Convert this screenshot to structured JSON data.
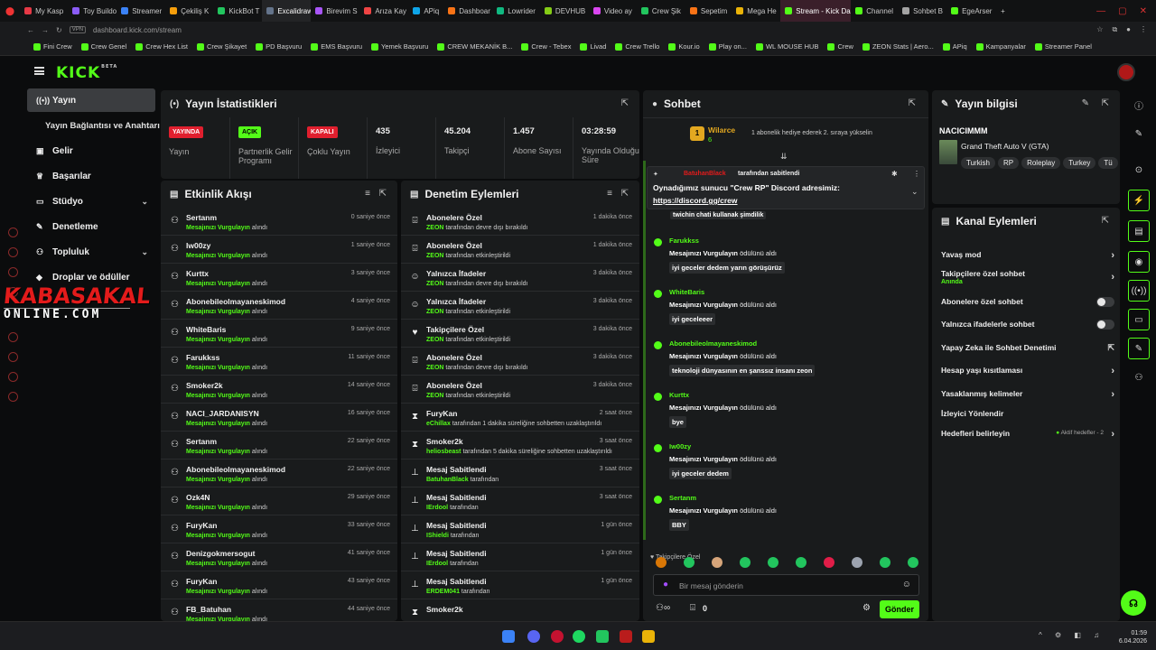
{
  "browser": {
    "tabs": [
      "My Kasp",
      "Toy Buildo",
      "Streamer",
      "Çekiliş K",
      "KickBot T",
      "Excalidraw",
      "Birevim S",
      "Arıza Kay",
      "APiq",
      "Dashboar",
      "Lowrider",
      "DEVHUB",
      "Video ay",
      "Crew Şik",
      "Sepetim",
      "Mega He",
      "Stream - Kick Da",
      "Channel",
      "Sohbet B",
      "EgeArser"
    ],
    "new_tab": "+",
    "url": "dashboard.kick.com/stream",
    "vpn": "VPN",
    "bookmarks": [
      "Fini Crew",
      "Crew Genel",
      "Crew Hex List",
      "Crew Şikayet",
      "PD Başvuru",
      "EMS Başvuru",
      "Yemek Başvuru",
      "CREW MEKANİK B...",
      "Crew - Tebex",
      "Livad",
      "Crew Trello",
      "Kour.io",
      "Play on...",
      "WL MOUSE HUB",
      "Crew",
      "ZEON Stats | Aero...",
      "APiq",
      "Kampanyalar",
      "Streamer Panel"
    ]
  },
  "logo": {
    "text": "KICK",
    "beta": "BETA"
  },
  "sidebar": {
    "yayin": "Yayın",
    "baglanti": "Yayın Bağlantısı ve Anahtarı",
    "gelir": "Gelir",
    "basarilar": "Başarılar",
    "studyo": "Stüdyo",
    "denetleme": "Denetleme",
    "topluluk": "Topluluk",
    "droplar": "Droplar ve ödüller"
  },
  "watermark": {
    "line1": "KABASAKAL",
    "line2": "ONLINE.COM"
  },
  "stats": {
    "title": "Yayın İstatistikleri",
    "items": [
      {
        "badge": "YAYINDA",
        "label": "Yayın"
      },
      {
        "badge": "AÇIK",
        "label": "Partnerlik Gelir Programı"
      },
      {
        "badge": "KAPALI",
        "label": "Çoklu Yayın"
      },
      {
        "value": "435",
        "label": "İzleyici"
      },
      {
        "value": "45.204",
        "label": "Takipçi"
      },
      {
        "value": "1.457",
        "label": "Abone Sayısı"
      },
      {
        "value": "03:28:59",
        "label": "Yayında Olduğu Süre"
      }
    ]
  },
  "activity": {
    "title": "Etkinlik Akışı",
    "prefix": "Mesajınızı Vurgulayın",
    "suffix": "alındı",
    "rows": [
      {
        "name": "Sertanm",
        "time": "0 saniye önce"
      },
      {
        "name": "Iw00zy",
        "time": "1 saniye önce"
      },
      {
        "name": "Kurttx",
        "time": "3 saniye önce"
      },
      {
        "name": "Abonebileolmayaneskimod",
        "time": "4 saniye önce"
      },
      {
        "name": "WhiteBaris",
        "time": "9 saniye önce"
      },
      {
        "name": "Farukkss",
        "time": "11 saniye önce"
      },
      {
        "name": "Smoker2k",
        "time": "14 saniye önce"
      },
      {
        "name": "NACI_JARDANISYN",
        "time": "16 saniye önce"
      },
      {
        "name": "Sertanm",
        "time": "22 saniye önce"
      },
      {
        "name": "Abonebileolmayaneskimod",
        "time": "22 saniye önce"
      },
      {
        "name": "Ozk4N",
        "time": "29 saniye önce"
      },
      {
        "name": "FuryKan",
        "time": "33 saniye önce"
      },
      {
        "name": "Denizgokmersogut",
        "time": "41 saniye önce"
      },
      {
        "name": "FuryKan",
        "time": "43 saniye önce"
      },
      {
        "name": "FB_Batuhan",
        "time": "44 saniye önce"
      }
    ]
  },
  "moderation": {
    "title": "Denetim Eylemleri",
    "rows": [
      {
        "title": "Abonelere Özel",
        "user": "ZEON",
        "text": "tarafından devre dışı bırakıldı",
        "time": "1 dakika önce",
        "icon": "gift-icon"
      },
      {
        "title": "Abonelere Özel",
        "user": "ZEON",
        "text": "tarafından etkinleştirildi",
        "time": "1 dakika önce",
        "icon": "gift-icon"
      },
      {
        "title": "Yalnızca İfadeler",
        "user": "ZEON",
        "text": "tarafından devre dışı bırakıldı",
        "time": "3 dakika önce",
        "icon": "smile-icon"
      },
      {
        "title": "Yalnızca İfadeler",
        "user": "ZEON",
        "text": "tarafından etkinleştirildi",
        "time": "3 dakika önce",
        "icon": "smile-icon"
      },
      {
        "title": "Takipçilere Özel",
        "user": "ZEON",
        "text": "tarafından etkinleştirildi",
        "time": "3 dakika önce",
        "icon": "heart-icon"
      },
      {
        "title": "Abonelere Özel",
        "user": "ZEON",
        "text": "tarafından devre dışı bırakıldı",
        "time": "3 dakika önce",
        "icon": "gift-icon"
      },
      {
        "title": "Abonelere Özel",
        "user": "ZEON",
        "text": "tarafından etkinleştirildi",
        "time": "3 dakika önce",
        "icon": "gift-icon"
      },
      {
        "title": "FuryKan",
        "user": "eChillax",
        "text": "tarafından 1 dakika süreliğine sohbetten uzaklaştırıldı",
        "time": "2 saat önce",
        "icon": "hourglass-icon"
      },
      {
        "title": "Smoker2k",
        "user": "heliosbeast",
        "text": "tarafından 5 dakika süreliğine sohbetten uzaklaştırıldı",
        "time": "3 saat önce",
        "icon": "hourglass-icon"
      },
      {
        "title": "Mesaj Sabitlendi",
        "user": "BatuhanBlack",
        "text": "tarafından",
        "time": "3 saat önce",
        "icon": "pin-icon"
      },
      {
        "title": "Mesaj Sabitlendi",
        "user": "IErdool",
        "text": "tarafından",
        "time": "3 saat önce",
        "icon": "pin-icon"
      },
      {
        "title": "Mesaj Sabitlendi",
        "user": "IShieldi",
        "text": "tarafından",
        "time": "1 gün önce",
        "icon": "pin-icon"
      },
      {
        "title": "Mesaj Sabitlendi",
        "user": "IErdool",
        "text": "tarafından",
        "time": "1 gün önce",
        "icon": "pin-icon"
      },
      {
        "title": "Mesaj Sabitlendi",
        "user": "ERDEM041",
        "text": "tarafından",
        "time": "1 gün önce",
        "icon": "pin-icon"
      },
      {
        "title": "Smoker2k",
        "user": "",
        "text": "",
        "time": "",
        "icon": "hourglass-icon"
      }
    ]
  },
  "chat": {
    "title": "Sohbet",
    "top_user": "Wilarce",
    "top_rank": "1",
    "top_count": "6",
    "top_note": "1 abonelik hediye ederek 2. sıraya yükselin",
    "pinned_by": "BatuhanBlack",
    "pinned_suffix": "tarafından sabitlendi",
    "pinned_text": "Oynadığımız sunucu \"Crew RP\" Discord adresimiz:",
    "pinned_link": "https://discord.gg/crew",
    "prev_msg": "twichin chati kullanak şimdilik",
    "reward_line": "Mesajınızı Vurgulayın",
    "reward_suffix": "ödülünü aldı",
    "messages": [
      {
        "name": "Farukkss",
        "msg": "iyi geceler dedem yarın görüşürüz"
      },
      {
        "name": "WhiteBaris",
        "msg": "iyi geceleeer"
      },
      {
        "name": "Abonebileolmayaneskimod",
        "msg": "teknoloji dünyasının en şanssız insanı zeon"
      },
      {
        "name": "Kurttx",
        "msg": "bye"
      },
      {
        "name": "Iw00zy",
        "msg": "iyi geceler dedem"
      },
      {
        "name": "Sertanm",
        "msg": "BBY"
      }
    ],
    "quick_label": "Takipçilere Özel",
    "input_placeholder": "Bir mesaj gönderin",
    "count": "0",
    "send": "Gönder"
  },
  "stream_info": {
    "title": "Yayın bilgisi",
    "stream_title": "NACICIMMM",
    "category": "Grand Theft Auto V (GTA)",
    "tags": [
      "Turkish",
      "RP",
      "Roleplay",
      "Turkey",
      "Tü"
    ]
  },
  "channel_actions": {
    "title": "Kanal Eylemleri",
    "slow": "Yavaş mod",
    "followers": "Takipçilere özel sohbet",
    "followers_sub": "Anında",
    "subs": "Abonelere özel sohbet",
    "emotes": "Yalnızca ifadelerle sohbet",
    "ai": "Yapay Zeka ile Sohbet Denetimi",
    "age": "Hesap yaşı kısıtlaması",
    "banned": "Yasaklanmış kelimeler",
    "redirect": "İzleyici Yönlendir",
    "goals": "Hedefleri belirleyin",
    "goals_sub": "Aktif hedefler - 2"
  },
  "taskbar": {
    "time": "01:59",
    "date": "6.04.2026"
  },
  "colors": {
    "accent": "#53fc18",
    "live": "#e01f2e",
    "bg": "#0b0c0d",
    "panel": "#191b1c"
  }
}
